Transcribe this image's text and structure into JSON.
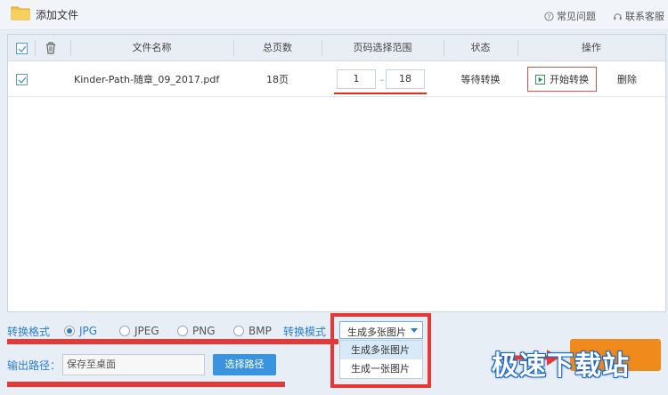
{
  "topbar": {
    "add_file": "添加文件",
    "faq": "常见问题",
    "service": "联系客服"
  },
  "table": {
    "headers": {
      "filename": "文件名称",
      "pages": "总页数",
      "range": "页码选择范围",
      "status": "状态",
      "action": "操作"
    },
    "rows": [
      {
        "checked": true,
        "filename": "Kinder-Path-随章_09_2017.pdf",
        "pages": "18页",
        "range_from": "1",
        "range_to": "18",
        "status": "等待转换",
        "start_label": "开始转换",
        "delete_label": "删除"
      }
    ]
  },
  "options": {
    "format_label": "转换格式",
    "formats": [
      "JPG",
      "JPEG",
      "PNG",
      "BMP"
    ],
    "selected_format": "JPG",
    "mode_label": "转换模式",
    "mode_value": "生成多张图片",
    "mode_options": [
      "生成多张图片",
      "生成一张图片"
    ],
    "output_label": "输出路径：",
    "output_value": "保存至桌面",
    "choose_path": "选择路径"
  },
  "watermark": "极速下载站",
  "colors": {
    "accent": "#2a7fd4",
    "highlight_red": "#e53838",
    "start_orange": "#f08a1c"
  }
}
